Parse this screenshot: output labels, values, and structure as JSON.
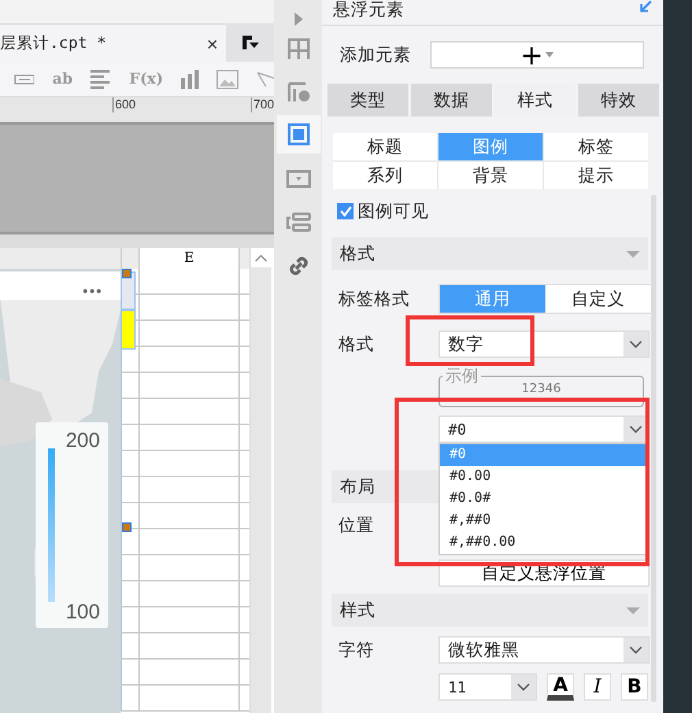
{
  "document_tab": {
    "title": "层累计.cpt *",
    "close": "×"
  },
  "toolbar": [
    {
      "kind": "textbox"
    },
    {
      "kind": "text",
      "label": "ab"
    },
    {
      "kind": "lines"
    },
    {
      "kind": "text",
      "label": "F(x)"
    },
    {
      "kind": "bars"
    },
    {
      "kind": "image"
    },
    {
      "kind": "pointer"
    }
  ],
  "ruler": {
    "marks": [
      "600",
      "700"
    ]
  },
  "sheet": {
    "column_header": "E",
    "more": "•••",
    "legend": {
      "max": "200",
      "min": "100"
    }
  },
  "sidebar": {
    "icons": [
      {
        "kind": "play",
        "selected": false
      },
      {
        "kind": "grid",
        "selected": false
      },
      {
        "kind": "grid-info",
        "selected": false
      },
      {
        "kind": "frame",
        "selected": true
      },
      {
        "kind": "dropdown",
        "selected": false
      },
      {
        "kind": "layout",
        "selected": false
      },
      {
        "kind": "link",
        "selected": false
      }
    ]
  },
  "panel": {
    "title": "悬浮元素",
    "add_label": "添加元素",
    "add_button": "+",
    "tabs": [
      {
        "label": "类型",
        "selected": false
      },
      {
        "label": "数据",
        "selected": false
      },
      {
        "label": "样式",
        "selected": true
      },
      {
        "label": "特效",
        "selected": false
      }
    ],
    "subtabs": [
      {
        "label": "标题",
        "selected": false
      },
      {
        "label": "图例",
        "selected": true
      },
      {
        "label": "标签",
        "selected": false
      },
      {
        "label": "系列",
        "selected": false
      },
      {
        "label": "背景",
        "selected": false
      },
      {
        "label": "提示",
        "selected": false
      }
    ],
    "legend_visible": {
      "label": "图例可见",
      "checked": true
    },
    "format_section": {
      "title": "格式",
      "label_format_label": "标签格式",
      "label_format": [
        {
          "label": "通用",
          "selected": true
        },
        {
          "label": "自定义",
          "selected": false
        }
      ],
      "format_label": "格式",
      "format_value": "数字",
      "example_legend": "示例",
      "example_value": "12346",
      "pattern_value": "#0",
      "pattern_options": [
        {
          "label": "#0",
          "selected": true
        },
        {
          "label": "#0.00",
          "selected": false
        },
        {
          "label": "#0.0#",
          "selected": false
        },
        {
          "label": "#,##0",
          "selected": false
        },
        {
          "label": "#,##0.00",
          "selected": false
        }
      ]
    },
    "layout_section": {
      "title": "布局",
      "position_label": "位置",
      "custom_button": "自定义悬浮位置"
    },
    "style_section": {
      "title": "样式",
      "font_label": "字符",
      "font_value": "微软雅黑",
      "size_value": "11",
      "buttons": [
        {
          "kind": "color",
          "label": "A"
        },
        {
          "kind": "italic",
          "label": "I"
        },
        {
          "kind": "bold",
          "label": "B"
        }
      ]
    }
  }
}
